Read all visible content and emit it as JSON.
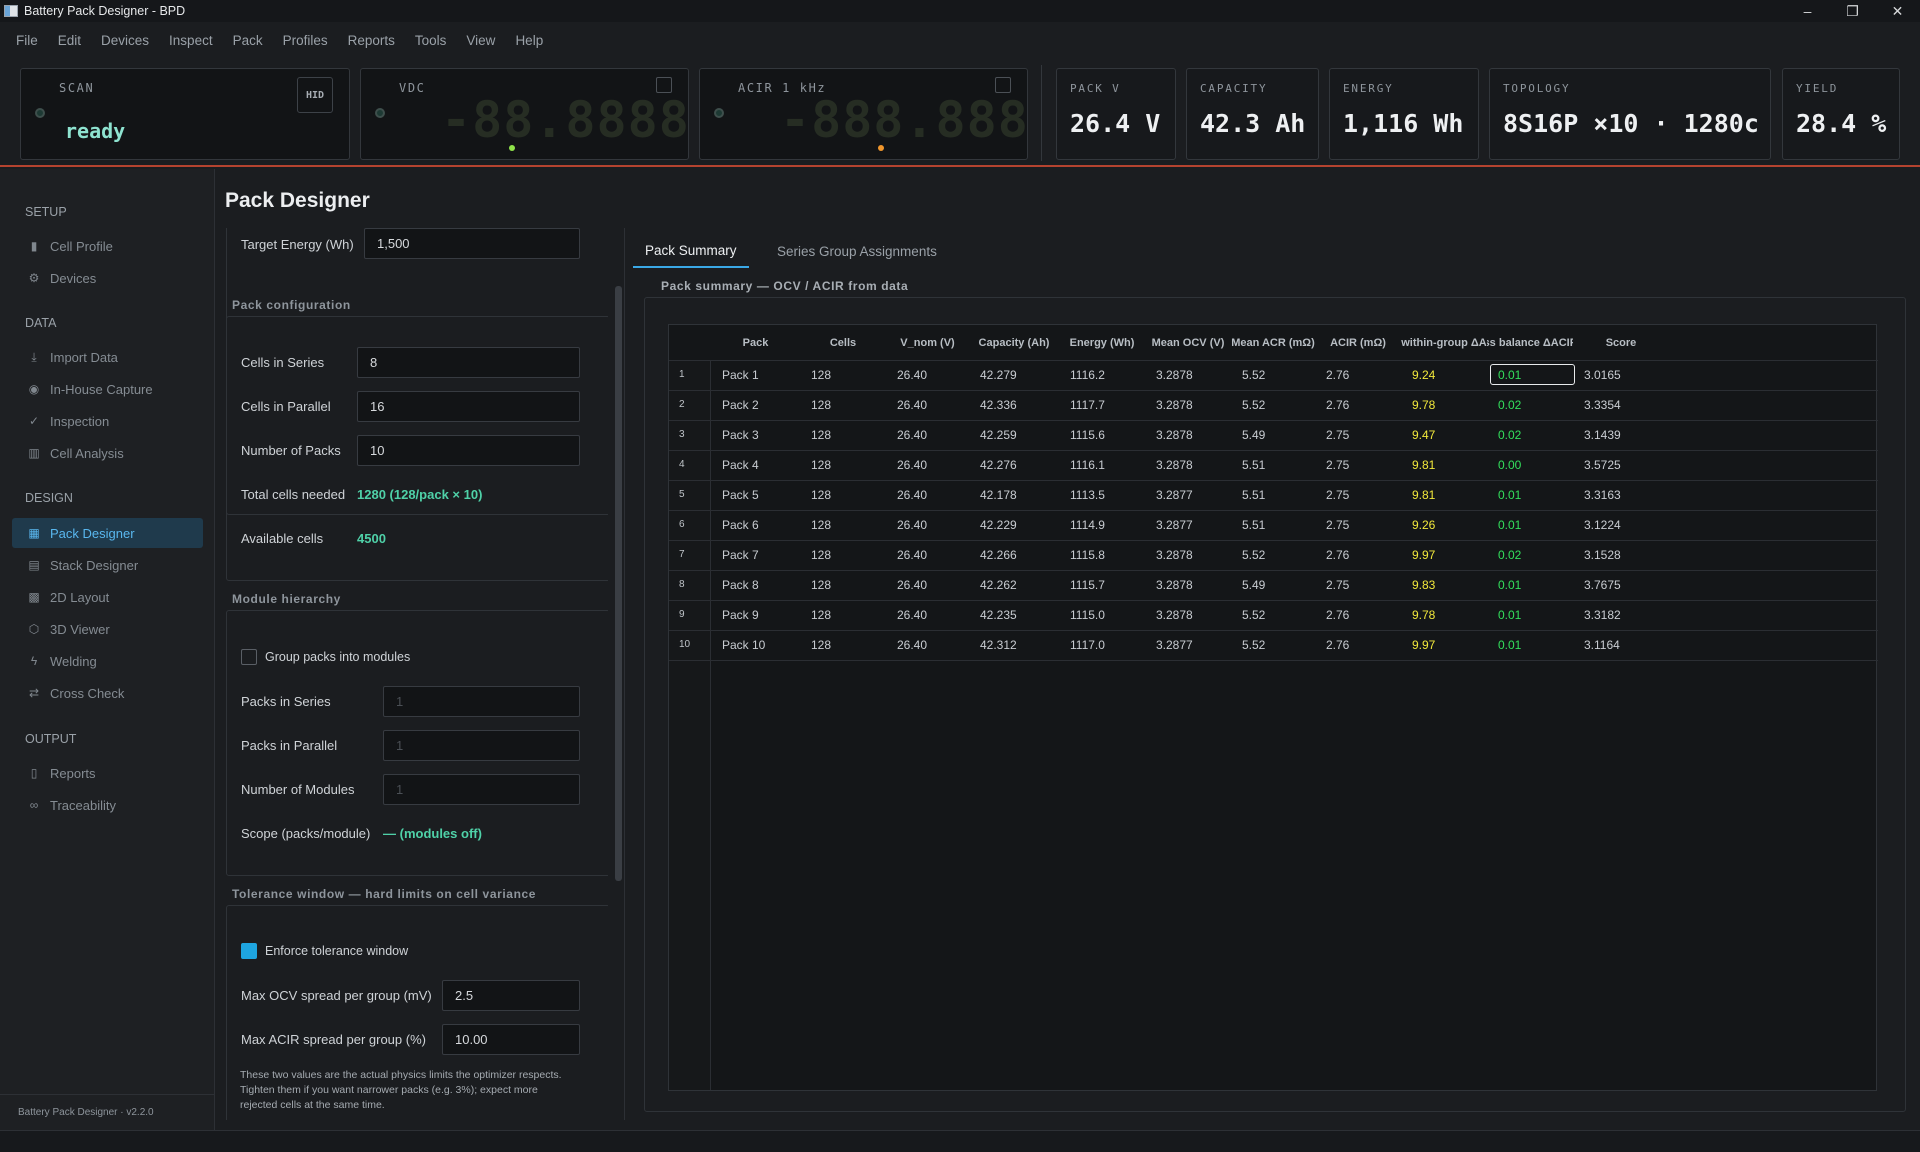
{
  "window": {
    "title": "Battery Pack Designer - BPD",
    "controls": [
      "–",
      "❐",
      "✕"
    ]
  },
  "menu": [
    "File",
    "Edit",
    "Devices",
    "Inspect",
    "Pack",
    "Profiles",
    "Reports",
    "Tools",
    "View",
    "Help"
  ],
  "scan": {
    "label": "SCAN",
    "status": "ready",
    "hid": "HID"
  },
  "vdc": {
    "label": "VDC",
    "digits": "-88.8888"
  },
  "acir": {
    "label": "ACIR  1 kHz",
    "digits": "-888.888"
  },
  "stats": [
    {
      "label": "PACK V",
      "value": "26.4 V"
    },
    {
      "label": "CAPACITY",
      "value": "42.3 Ah"
    },
    {
      "label": "ENERGY",
      "value": "1,116 Wh"
    },
    {
      "label": "TOPOLOGY",
      "value": "8S16P ×10 · 1280c"
    },
    {
      "label": "YIELD",
      "value": "28.4 %"
    }
  ],
  "sidebar": {
    "sections": {
      "setup": "SETUP",
      "data": "DATA",
      "design": "DESIGN",
      "output": "OUTPUT"
    },
    "items": [
      {
        "label": "Cell Profile",
        "icon": "battery-icon"
      },
      {
        "label": "Devices",
        "icon": "gear-icon"
      },
      {
        "label": "Import Data",
        "icon": "download-icon"
      },
      {
        "label": "In-House Capture",
        "icon": "target-icon"
      },
      {
        "label": "Inspection",
        "icon": "check-icon"
      },
      {
        "label": "Cell Analysis",
        "icon": "bar-chart-icon"
      },
      {
        "label": "Pack Designer",
        "icon": "grid-icon"
      },
      {
        "label": "Stack Designer",
        "icon": "layers-icon"
      },
      {
        "label": "2D Layout",
        "icon": "layout-icon"
      },
      {
        "label": "3D Viewer",
        "icon": "cube-icon"
      },
      {
        "label": "Welding",
        "icon": "lightning-icon"
      },
      {
        "label": "Cross Check",
        "icon": "swap-icon"
      },
      {
        "label": "Reports",
        "icon": "document-icon"
      },
      {
        "label": "Traceability",
        "icon": "link-icon"
      }
    ],
    "version": "Battery Pack Designer · v2.2.0"
  },
  "page": {
    "title": "Pack Designer"
  },
  "form": {
    "target_energy": {
      "label": "Target Energy (Wh)",
      "value": "1,500"
    },
    "pack_config": {
      "title": "Pack configuration",
      "cells_series": {
        "label": "Cells in Series",
        "value": "8"
      },
      "cells_parallel": {
        "label": "Cells in Parallel",
        "value": "16"
      },
      "num_packs": {
        "label": "Number of Packs",
        "value": "10"
      },
      "total": {
        "label": "Total cells needed",
        "value": "1280  (128/pack × 10)"
      },
      "available": {
        "label": "Available cells",
        "value": "4500"
      }
    },
    "module": {
      "title": "Module hierarchy",
      "group": "Group packs into modules",
      "packs_series": {
        "label": "Packs in Series",
        "value": "1"
      },
      "packs_parallel": {
        "label": "Packs in Parallel",
        "value": "1"
      },
      "num_modules": {
        "label": "Number of Modules",
        "value": "1"
      },
      "scope": {
        "label": "Scope (packs/module)",
        "value": "— (modules off)"
      }
    },
    "tolerance": {
      "title": "Tolerance window — hard limits on cell variance",
      "enforce": "Enforce tolerance window",
      "ocv": {
        "label": "Max OCV spread per group (mV)",
        "value": "2.5"
      },
      "acir": {
        "label": "Max ACIR spread per group (%)",
        "value": "10.00"
      },
      "note_lines": [
        "These two values are the actual physics limits the optimizer respects.",
        "Tighten them if you want narrower packs (e.g. 3%); expect more",
        "rejected cells at the same time."
      ]
    }
  },
  "tabs": [
    "Pack Summary",
    "Series Group Assignments"
  ],
  "summary": {
    "title": "Pack summary — OCV / ACIR from data",
    "headers": [
      "Pack",
      "Cells",
      "V_nom (V)",
      "Capacity (Ah)",
      "Energy (Wh)",
      "Mean OCV (V)",
      "Mean ACR (mΩ)",
      "ACIR (mΩ)",
      "within-group ΔA",
      "ss balance ΔACIF",
      "Score"
    ],
    "rows": [
      [
        "1",
        "Pack 1",
        "128",
        "26.40",
        "42.279",
        "1116.2",
        "3.2878",
        "5.52",
        "2.76",
        "9.24",
        "0.01",
        "3.0165"
      ],
      [
        "2",
        "Pack 2",
        "128",
        "26.40",
        "42.336",
        "1117.7",
        "3.2878",
        "5.52",
        "2.76",
        "9.78",
        "0.02",
        "3.3354"
      ],
      [
        "3",
        "Pack 3",
        "128",
        "26.40",
        "42.259",
        "1115.6",
        "3.2878",
        "5.49",
        "2.75",
        "9.47",
        "0.02",
        "3.1439"
      ],
      [
        "4",
        "Pack 4",
        "128",
        "26.40",
        "42.276",
        "1116.1",
        "3.2878",
        "5.51",
        "2.75",
        "9.81",
        "0.00",
        "3.5725"
      ],
      [
        "5",
        "Pack 5",
        "128",
        "26.40",
        "42.178",
        "1113.5",
        "3.2877",
        "5.51",
        "2.75",
        "9.81",
        "0.01",
        "3.3163"
      ],
      [
        "6",
        "Pack 6",
        "128",
        "26.40",
        "42.229",
        "1114.9",
        "3.2877",
        "5.51",
        "2.75",
        "9.26",
        "0.01",
        "3.1224"
      ],
      [
        "7",
        "Pack 7",
        "128",
        "26.40",
        "42.266",
        "1115.8",
        "3.2878",
        "5.52",
        "2.76",
        "9.97",
        "0.02",
        "3.1528"
      ],
      [
        "8",
        "Pack 8",
        "128",
        "26.40",
        "42.262",
        "1115.7",
        "3.2878",
        "5.49",
        "2.75",
        "9.83",
        "0.01",
        "3.7675"
      ],
      [
        "9",
        "Pack 9",
        "128",
        "26.40",
        "42.235",
        "1115.0",
        "3.2878",
        "5.52",
        "2.76",
        "9.78",
        "0.01",
        "3.3182"
      ],
      [
        "10",
        "Pack 10",
        "128",
        "26.40",
        "42.312",
        "1117.0",
        "3.2877",
        "5.52",
        "2.76",
        "9.97",
        "0.01",
        "3.1164"
      ]
    ]
  },
  "colors": {
    "accent": "#3aa8e6",
    "teal": "#4fd1a8",
    "warn": "#f2e83b",
    "ok": "#33e05c",
    "divider": "#b5432f"
  }
}
